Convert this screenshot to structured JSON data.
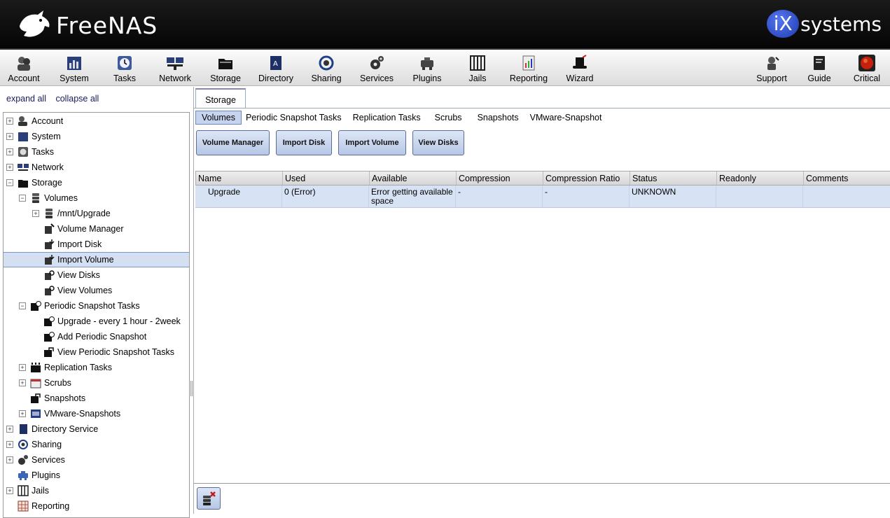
{
  "header": {
    "logo_text": "FreeNAS",
    "brand_ix": "iX",
    "brand_systems": "systems"
  },
  "toolbar": {
    "items": [
      {
        "label": "Account",
        "icon": "account-icon"
      },
      {
        "label": "System",
        "icon": "system-icon"
      },
      {
        "label": "Tasks",
        "icon": "tasks-icon"
      },
      {
        "label": "Network",
        "icon": "network-icon"
      },
      {
        "label": "Storage",
        "icon": "storage-icon"
      },
      {
        "label": "Directory",
        "icon": "directory-icon"
      },
      {
        "label": "Sharing",
        "icon": "sharing-icon"
      },
      {
        "label": "Services",
        "icon": "services-icon"
      },
      {
        "label": "Plugins",
        "icon": "plugins-icon"
      },
      {
        "label": "Jails",
        "icon": "jails-icon"
      },
      {
        "label": "Reporting",
        "icon": "reporting-icon"
      },
      {
        "label": "Wizard",
        "icon": "wizard-icon"
      },
      {
        "label": "Support",
        "icon": "support-icon"
      },
      {
        "label": "Guide",
        "icon": "guide-icon"
      },
      {
        "label": "Critical",
        "icon": "critical-icon"
      }
    ]
  },
  "left": {
    "expand_all": "expand all",
    "collapse_all": "collapse all",
    "tree": [
      {
        "label": "Account",
        "toggle": "+"
      },
      {
        "label": "System",
        "toggle": "+"
      },
      {
        "label": "Tasks",
        "toggle": "+"
      },
      {
        "label": "Network",
        "toggle": "+"
      },
      {
        "label": "Storage",
        "toggle": "−"
      },
      {
        "label": "Volumes",
        "toggle": "−"
      },
      {
        "label": "/mnt/Upgrade",
        "toggle": "+"
      },
      {
        "label": "Volume Manager",
        "toggle": ""
      },
      {
        "label": "Import Disk",
        "toggle": ""
      },
      {
        "label": "Import Volume",
        "toggle": ""
      },
      {
        "label": "View Disks",
        "toggle": ""
      },
      {
        "label": "View Volumes",
        "toggle": ""
      },
      {
        "label": "Periodic Snapshot Tasks",
        "toggle": "−"
      },
      {
        "label": "Upgrade - every 1 hour - 2week",
        "toggle": ""
      },
      {
        "label": "Add Periodic Snapshot",
        "toggle": ""
      },
      {
        "label": "View Periodic Snapshot Tasks",
        "toggle": ""
      },
      {
        "label": "Replication Tasks",
        "toggle": "+"
      },
      {
        "label": "Scrubs",
        "toggle": "+"
      },
      {
        "label": "Snapshots",
        "toggle": ""
      },
      {
        "label": "VMware-Snapshots",
        "toggle": "+"
      },
      {
        "label": "Directory Service",
        "toggle": "+"
      },
      {
        "label": "Sharing",
        "toggle": "+"
      },
      {
        "label": "Services",
        "toggle": "+"
      },
      {
        "label": "Plugins",
        "toggle": ""
      },
      {
        "label": "Jails",
        "toggle": "+"
      },
      {
        "label": "Reporting",
        "toggle": ""
      }
    ]
  },
  "main": {
    "tab": "Storage",
    "subtabs": [
      "Volumes",
      "Periodic Snapshot Tasks",
      "Replication Tasks",
      "Scrubs",
      "Snapshots",
      "VMware-Snapshot"
    ],
    "buttons": [
      "Volume Manager",
      "Import Disk",
      "Import Volume",
      "View Disks"
    ],
    "columns": [
      "Name",
      "Used",
      "Available",
      "Compression",
      "Compression Ratio",
      "Status",
      "Readonly",
      "Comments"
    ],
    "rows": [
      {
        "name": "Upgrade",
        "used": "0 (Error)",
        "available": "Error getting available space",
        "compression": "-",
        "ratio": "-",
        "status": "UNKNOWN",
        "readonly": "",
        "comments": ""
      }
    ]
  },
  "colors": {
    "header_bg": "#0d0d0d",
    "selected_row": "#d7e2f4",
    "button_bg": "#c6d4ee",
    "ix_blue": "#2a46c4"
  }
}
